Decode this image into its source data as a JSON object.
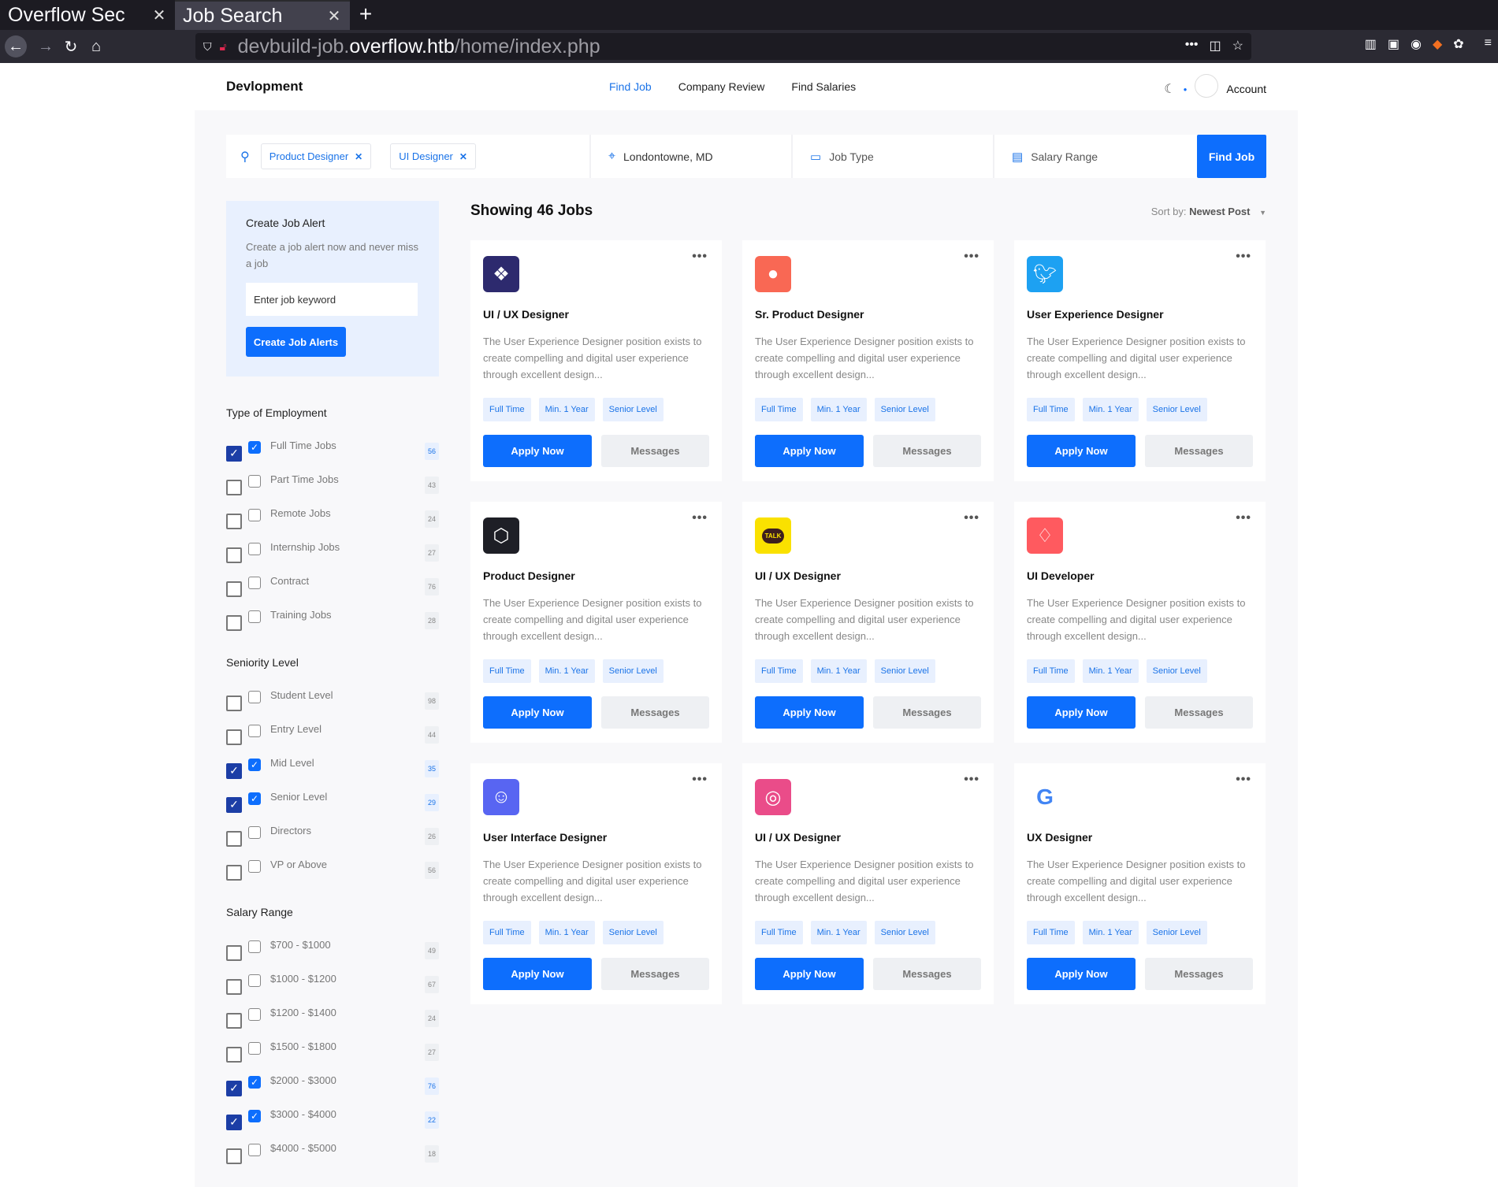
{
  "browser": {
    "tabs": [
      {
        "title": "Overflow Sec",
        "active": false
      },
      {
        "title": "Job Search",
        "active": true
      }
    ],
    "url_prefix": "devbuild-job.",
    "url_domain": "overflow.htb",
    "url_path": "/home/index.php"
  },
  "nav": {
    "brand": "Devlopment",
    "links": [
      "Find Job",
      "Company Review",
      "Find Salaries"
    ],
    "account": "Account"
  },
  "search": {
    "chips": [
      "Product Designer",
      "UI Designer"
    ],
    "location": "Londontowne, MD",
    "job_type": "Job Type",
    "salary": "Salary Range",
    "button": "Find Job"
  },
  "alert": {
    "title": "Create Job Alert",
    "text": "Create a job alert now and never miss a job",
    "placeholder": "Enter job keyword",
    "button": "Create Job Alerts"
  },
  "filters": [
    {
      "title": "Type of Employment",
      "items": [
        {
          "label": "Full Time Jobs",
          "count": "56",
          "checked": true
        },
        {
          "label": "Part Time Jobs",
          "count": "43",
          "checked": false
        },
        {
          "label": "Remote Jobs",
          "count": "24",
          "checked": false
        },
        {
          "label": "Internship Jobs",
          "count": "27",
          "checked": false
        },
        {
          "label": "Contract",
          "count": "76",
          "checked": false
        },
        {
          "label": "Training Jobs",
          "count": "28",
          "checked": false
        }
      ]
    },
    {
      "title": "Seniority Level",
      "items": [
        {
          "label": "Student Level",
          "count": "98",
          "checked": false
        },
        {
          "label": "Entry Level",
          "count": "44",
          "checked": false
        },
        {
          "label": "Mid Level",
          "count": "35",
          "checked": true
        },
        {
          "label": "Senior Level",
          "count": "29",
          "checked": true
        },
        {
          "label": "Directors",
          "count": "26",
          "checked": false
        },
        {
          "label": "VP or Above",
          "count": "56",
          "checked": false
        }
      ]
    },
    {
      "title": "Salary Range",
      "items": [
        {
          "label": "$700 - $1000",
          "count": "49",
          "checked": false
        },
        {
          "label": "$1000 - $1200",
          "count": "67",
          "checked": false
        },
        {
          "label": "$1200 - $1400",
          "count": "24",
          "checked": false
        },
        {
          "label": "$1500 - $1800",
          "count": "27",
          "checked": false
        },
        {
          "label": "$2000 - $3000",
          "count": "76",
          "checked": true
        },
        {
          "label": "$3000 - $4000",
          "count": "22",
          "checked": true
        },
        {
          "label": "$4000 - $5000",
          "count": "18",
          "checked": false
        }
      ]
    }
  ],
  "results": {
    "title": "Showing 46 Jobs",
    "sort_label": "Sort by:",
    "sort_value": "Newest Post"
  },
  "job_desc": "The User Experience Designer position exists to create compelling and digital user experience through excellent design...",
  "job_tags": [
    "Full Time",
    "Min. 1 Year",
    "Senior Level"
  ],
  "apply_label": "Apply Now",
  "messages_label": "Messages",
  "jobs": [
    {
      "title": "UI / UX Designer",
      "logo": "dropbox-icon",
      "color": "#2d2a6e"
    },
    {
      "title": "Sr. Product Designer",
      "logo": "patreon-icon",
      "color": "#f96854"
    },
    {
      "title": "User Experience Designer",
      "logo": "twitter-icon",
      "color": "#1da1f2"
    },
    {
      "title": "Product Designer",
      "logo": "codepen-icon",
      "color": "#1e1f26"
    },
    {
      "title": "UI / UX Designer",
      "logo": "kakaotalk-icon",
      "color": "#fae100",
      "logo_text": "TALK"
    },
    {
      "title": "UI Developer",
      "logo": "airbnb-icon",
      "color": "#ff5a5f"
    },
    {
      "title": "User Interface Designer",
      "logo": "discord-icon",
      "color": "#5865f2"
    },
    {
      "title": "UI / UX Designer",
      "logo": "dribbble-icon",
      "color": "#ea4c89"
    },
    {
      "title": "UX Designer",
      "logo": "google-icon",
      "color": "#ffffff",
      "logo_text": "G"
    }
  ]
}
